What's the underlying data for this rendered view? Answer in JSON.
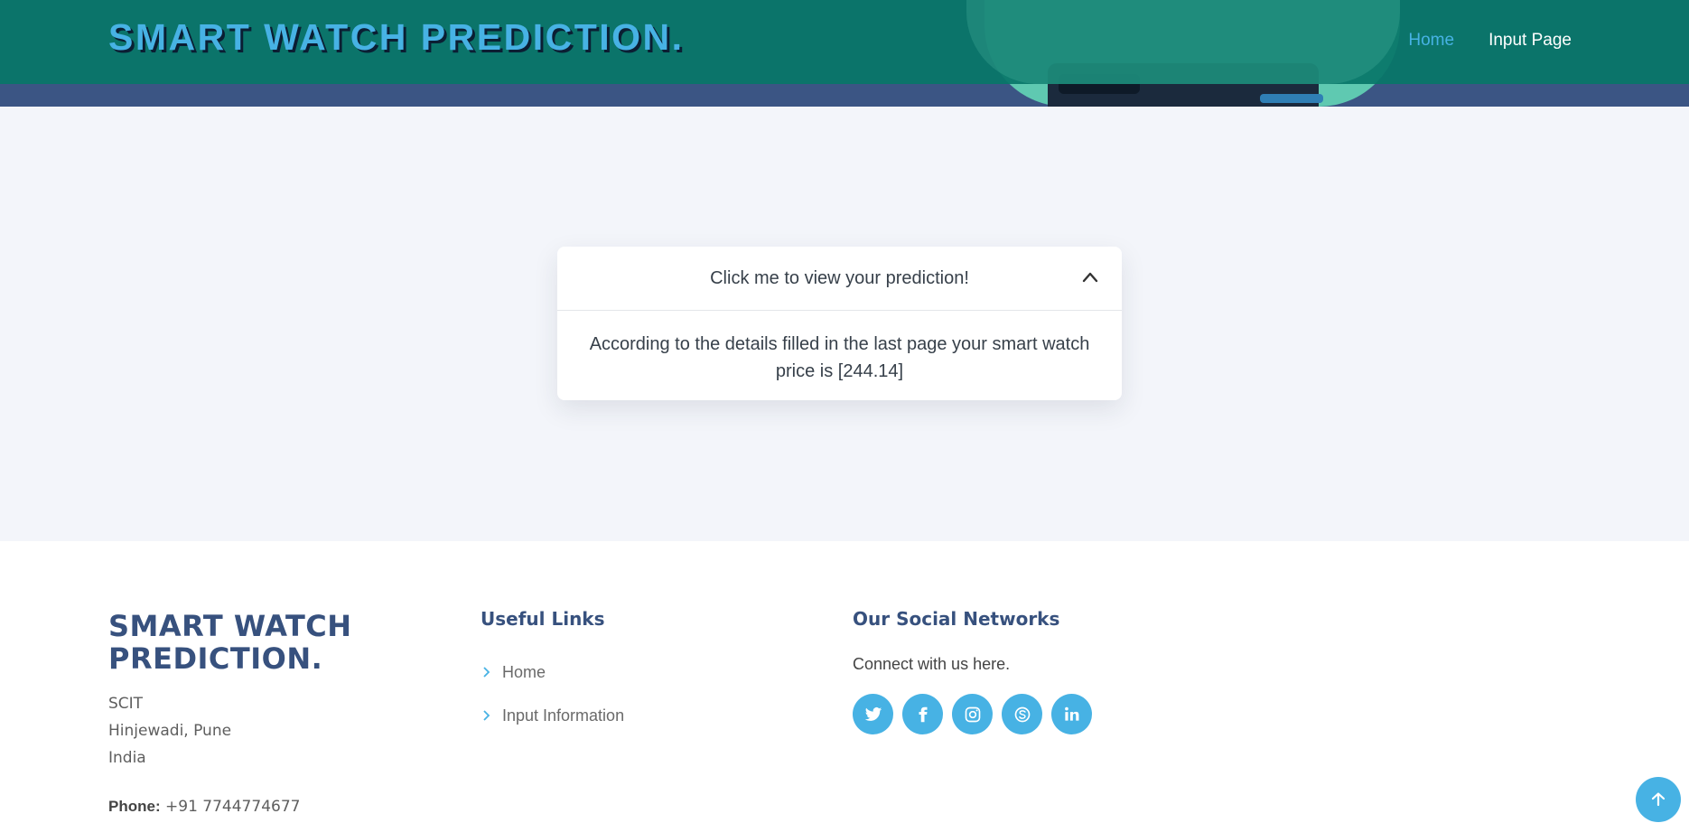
{
  "header": {
    "logo": "SMART WATCH PREDICTION.",
    "nav": [
      {
        "label": "Home",
        "active": true
      },
      {
        "label": "Input Page",
        "active": false
      }
    ]
  },
  "prediction_card": {
    "title": "Click me to view your prediction!",
    "icon": "chevron-up-icon",
    "body": "According to the details filled in the last page your smart watch price is [244.14]"
  },
  "footer": {
    "logo_line1": "SMART WATCH",
    "logo_line2": "PREDICTION.",
    "address": [
      "SCIT",
      "Hinjewadi, Pune",
      "India"
    ],
    "phone_label": "Phone:",
    "phone_value": "+91 7744774677",
    "useful_links_title": "Useful Links",
    "useful_links": [
      "Home",
      "Input Information"
    ],
    "social_title": "Our Social Networks",
    "social_text": "Connect with us here.",
    "social_icons": [
      "twitter-icon",
      "facebook-icon",
      "instagram-icon",
      "skype-icon",
      "linkedin-icon"
    ]
  },
  "colors": {
    "header_bg": "#087668",
    "accent": "#47b2e4",
    "brand_dark": "#37517e",
    "main_bg": "#f3f5fa"
  }
}
